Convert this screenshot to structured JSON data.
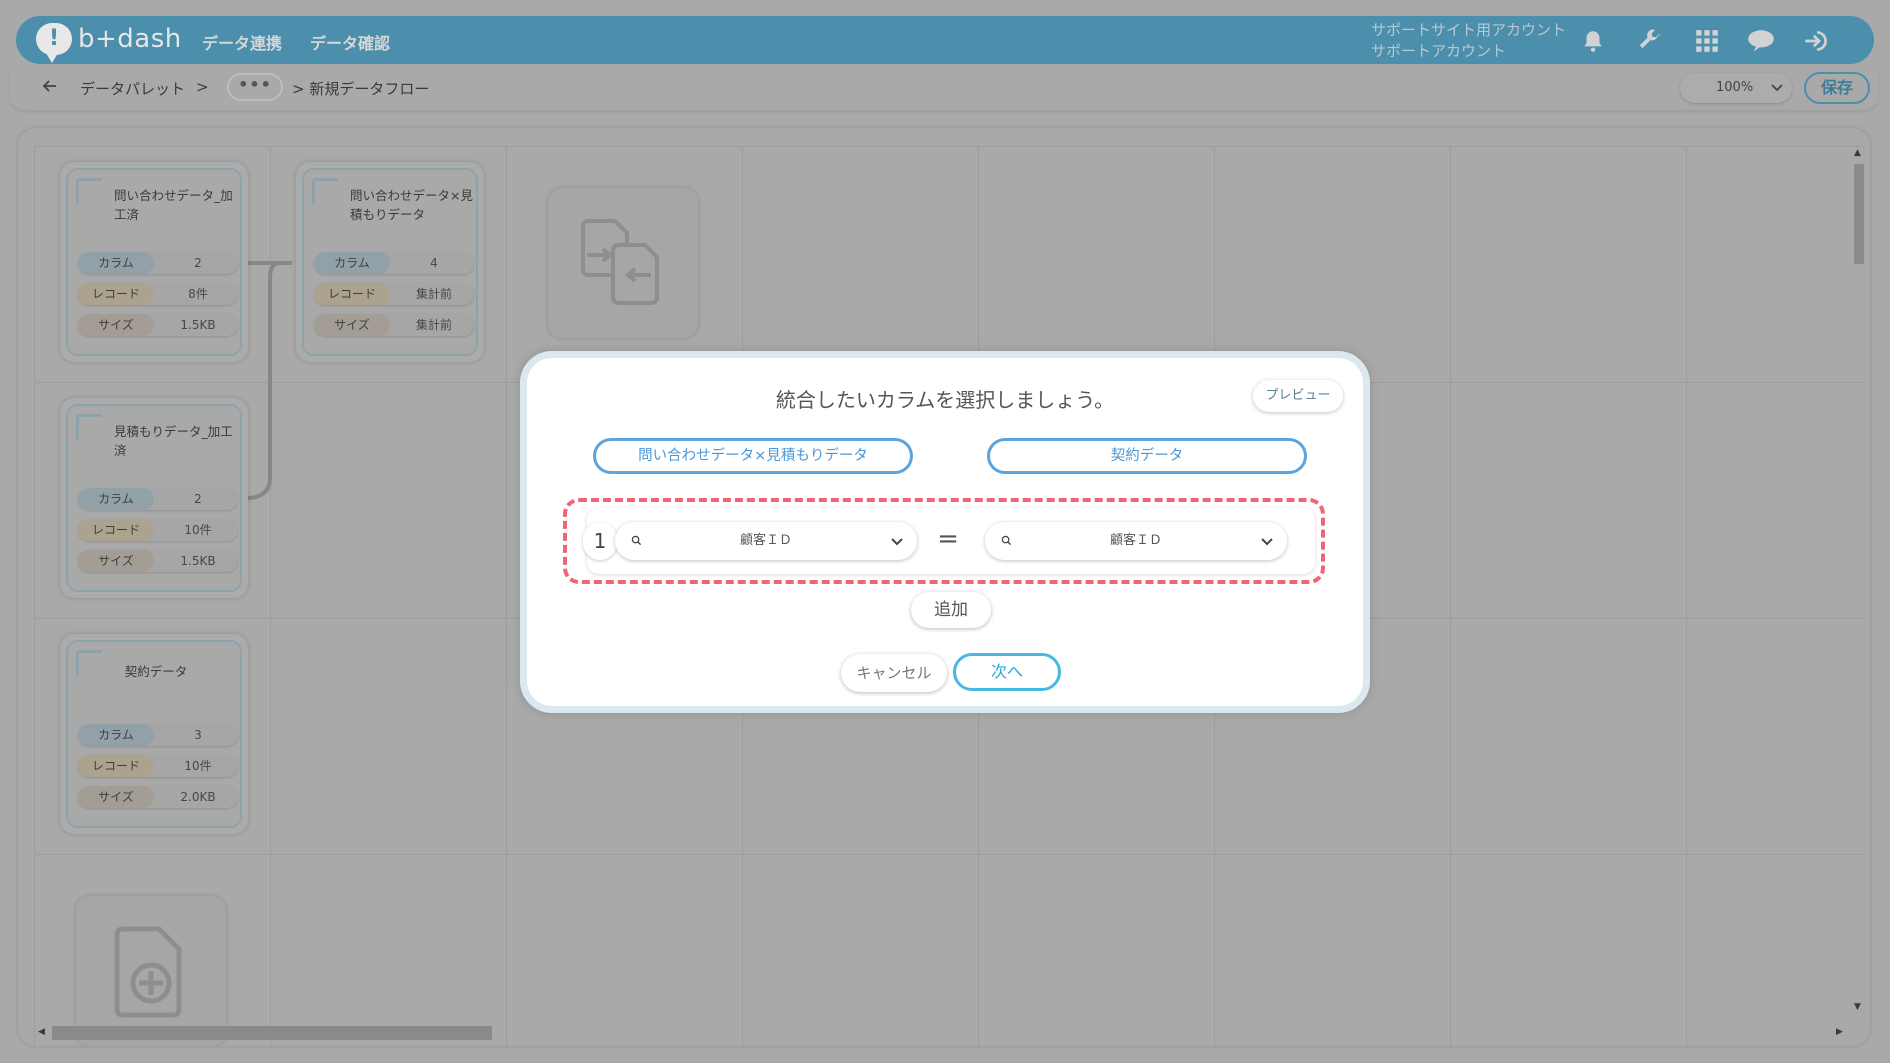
{
  "header": {
    "logo_text": "b+dash",
    "nav": [
      "データ連携",
      "データ確認"
    ],
    "account_line1": "サポートサイト用アカウント",
    "account_line2": "サポートアカウント",
    "icons": [
      "bell-icon",
      "wrench-icon",
      "grid-icon",
      "chat-icon",
      "logout-icon"
    ]
  },
  "breadcrumb": {
    "item1": "データパレット",
    "sep": ">",
    "more": "•••",
    "current": "> 新規データフロー"
  },
  "toolbar": {
    "zoom": "100%",
    "save_label": "保存"
  },
  "nodes": [
    {
      "title": "問い合わせデータ_加工済",
      "column_label": "カラム",
      "columns": "2",
      "record_label": "レコード",
      "records": "8件",
      "size_label": "サイズ",
      "size": "1.5KB"
    },
    {
      "title": "問い合わせデータ×見積もりデータ",
      "column_label": "カラム",
      "columns": "4",
      "record_label": "レコード",
      "records": "集計前",
      "size_label": "サイズ",
      "size": "集計前"
    },
    {
      "title": "見積もりデータ_加工済",
      "column_label": "カラム",
      "columns": "2",
      "record_label": "レコード",
      "records": "10件",
      "size_label": "サイズ",
      "size": "1.5KB"
    },
    {
      "title": "契約データ",
      "column_label": "カラム",
      "columns": "3",
      "record_label": "レコード",
      "records": "10件",
      "size_label": "サイズ",
      "size": "2.0KB"
    }
  ],
  "modal": {
    "title": "統合したいカラムを選択しましょう。",
    "preview_label": "プレビュー",
    "left_table": "問い合わせデータ×見積もりデータ",
    "right_table": "契約データ",
    "row_number": "1",
    "left_column": "顧客ＩＤ",
    "right_column": "顧客ＩＤ",
    "equals": "=",
    "add_label": "追加",
    "cancel_label": "キャンセル",
    "next_label": "次へ"
  },
  "colors": {
    "header_bg": "#4b8fad",
    "dashed_highlight": "#f06574",
    "pill_border": "#5ba4de",
    "next_border": "#45b9e2"
  }
}
